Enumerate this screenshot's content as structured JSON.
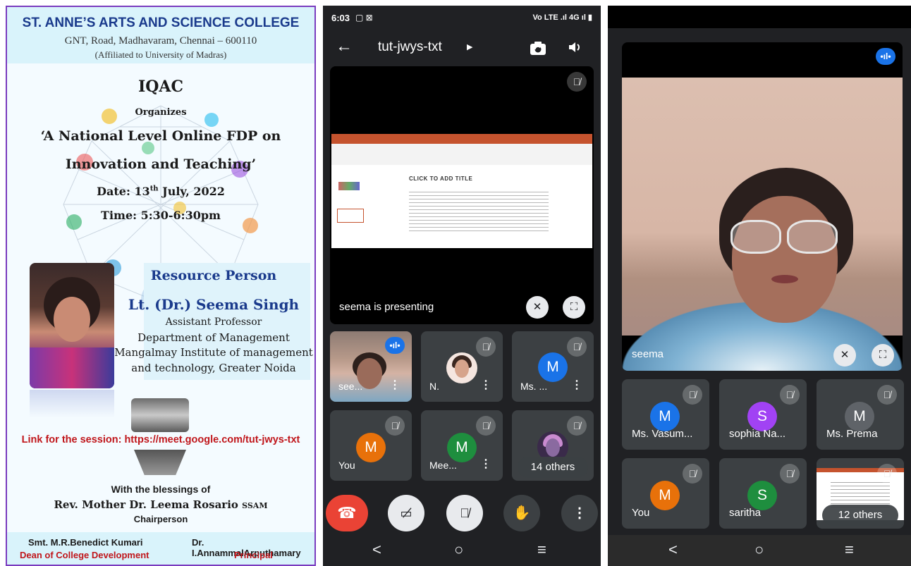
{
  "poster": {
    "college": "ST. ANNE’S ARTS AND SCIENCE COLLEGE",
    "address": "GNT, Road, Madhavaram, Chennai – 600110",
    "affiliation": "(Affiliated to University of Madras)",
    "iqac": "IQAC",
    "organizes": "Organizes",
    "title_line1": "‘A National Level Online FDP on",
    "title_line2": "Innovation and Teaching’",
    "date_prefix": "Date: 13",
    "date_sup": "th",
    "date_suffix": " July, 2022",
    "time": "Time: 5:30-6:30pm",
    "resource_title": "Resource Person",
    "resource_name": "Lt. (Dr.) Seema Singh",
    "resource_post": "Assistant Professor",
    "resource_dept": "Department of Management",
    "resource_inst": "Mangalmay Institute of management",
    "resource_inst2": "and technology, Greater Noida",
    "link": "Link for the session: https://meet.google.com/tut-jwys-txt",
    "blessings": "With the blessings of",
    "rev_name": "Rev. Mother Dr. Leema Rosario",
    "rev_suffix": "SSAM",
    "chairperson": "Chairperson",
    "footer_left_name": "Smt. M.R.Benedict Kumari",
    "footer_left_role": "Dean of College Development",
    "footer_right_name": "Dr. I.AnnammalArputhamary",
    "footer_right_role": "Principal",
    "colors": {
      "heading_blue": "#1a3a8c",
      "link_red": "#c0161b",
      "border_purple": "#7a3bbf"
    }
  },
  "phone1": {
    "status": {
      "time": "6:03",
      "icons": "▢ ⊠",
      "right": "Vo LTE .ıl 4G ıl ▮"
    },
    "toolbar": {
      "back": "←",
      "title": "tut-jwys-txt",
      "caret": "▶",
      "camera_icon": "camera-switch-icon",
      "volume_icon": "volume-icon"
    },
    "presentation": {
      "slide_title": "CLICK TO ADD TITLE",
      "label": "seema is presenting"
    },
    "tiles": [
      {
        "name": "see...",
        "avatar": ""
      },
      {
        "name": "N.",
        "avatar": ""
      },
      {
        "name": "Ms. ...",
        "avatar": "M"
      },
      {
        "name": "You",
        "avatar": "M"
      },
      {
        "name": "Mee...",
        "avatar": "M"
      },
      {
        "name": "14 others",
        "avatar": ""
      }
    ],
    "avatar_colors": {
      "blue": "#1a73e8",
      "orange": "#e8710a",
      "green": "#1e8e3e"
    },
    "controls": {
      "end_call_color": "#ea4335"
    }
  },
  "phone2": {
    "main": {
      "label": "seema"
    },
    "tiles": [
      {
        "name": "Ms. Vasum...",
        "avatar": "M"
      },
      {
        "name": "sophia Na...",
        "avatar": "S"
      },
      {
        "name": "Ms. Prema",
        "avatar": "M"
      },
      {
        "name": "You",
        "avatar": "M"
      },
      {
        "name": "saritha",
        "avatar": "S"
      },
      {
        "name": "12 others",
        "avatar": ""
      }
    ],
    "avatar_colors": {
      "blue": "#1a73e8",
      "purple": "#a142f4",
      "grey": "#5f6368",
      "orange": "#e8710a",
      "green": "#1e8e3e"
    }
  }
}
